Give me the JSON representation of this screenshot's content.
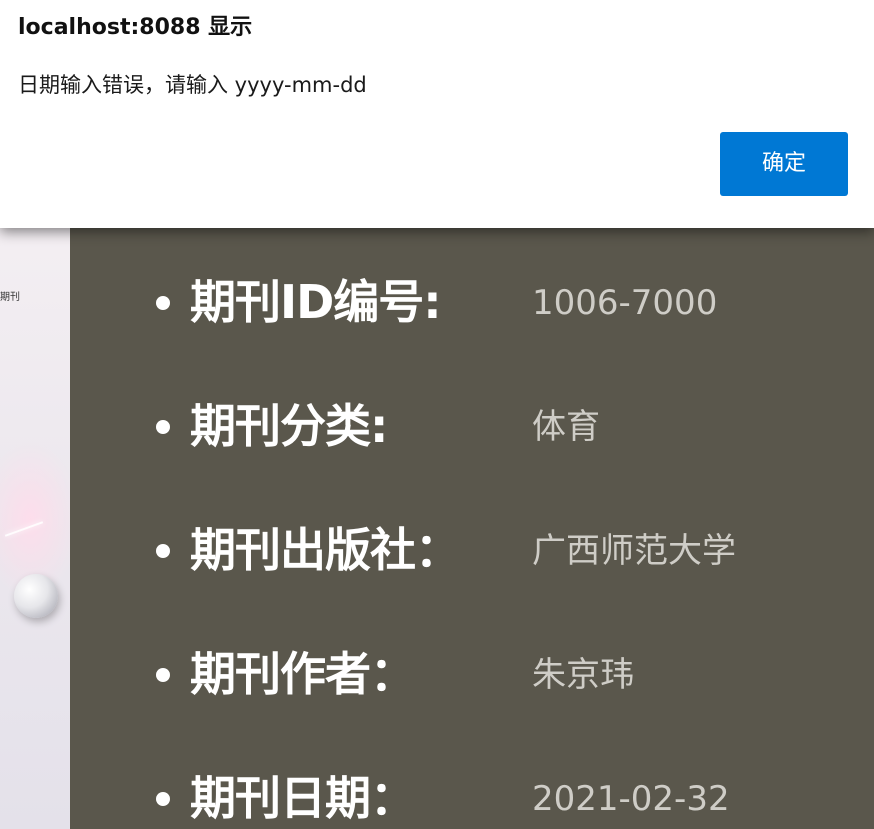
{
  "dialog": {
    "title": "localhost:8088 显示",
    "message": "日期输入错误，请输入 yyyy-mm-dd",
    "ok_label": "确定",
    "ok_color": "#0078d4"
  },
  "left_strip": {
    "caption": "期刊"
  },
  "details": {
    "items": [
      {
        "label": "期刊ID编号:",
        "value": "1006-7000"
      },
      {
        "label": "期刊分类:",
        "value": "体育"
      },
      {
        "label": "期刊出版社：",
        "value": "广西师范大学"
      },
      {
        "label": "期刊作者：",
        "value": "朱京玮"
      },
      {
        "label": "期刊日期：",
        "value": "2021-02-32"
      }
    ]
  },
  "colors": {
    "panel_bg": "#5a574c",
    "label_text": "#ffffff",
    "value_text": "#cfcdc7"
  }
}
